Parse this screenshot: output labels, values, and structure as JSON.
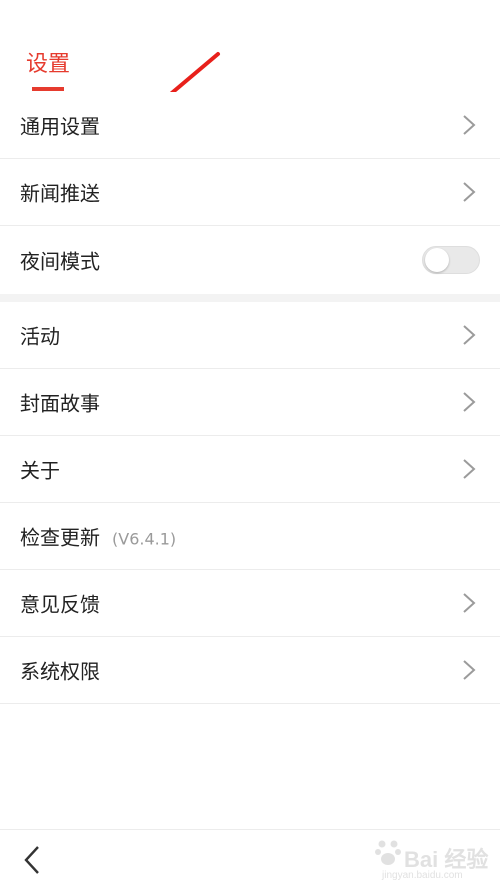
{
  "header": {
    "active_tab": "设置",
    "accent_color": "#e63b2e"
  },
  "settings": {
    "general": "通用设置",
    "news_push": "新闻推送",
    "night_mode": "夜间模式",
    "night_mode_enabled": false,
    "activities": "活动",
    "cover_story": "封面故事",
    "about": "关于",
    "check_update": "检查更新",
    "version": "(V6.4.1)",
    "feedback": "意见反馈",
    "permissions": "系统权限"
  },
  "icons": {
    "row_chevron": "chevron-right-icon",
    "back": "back-arrow-icon",
    "annotation": "red-arrow-icon"
  },
  "watermark": {
    "brand": "Bai 经验",
    "url": "jingyan.baidu.com"
  }
}
